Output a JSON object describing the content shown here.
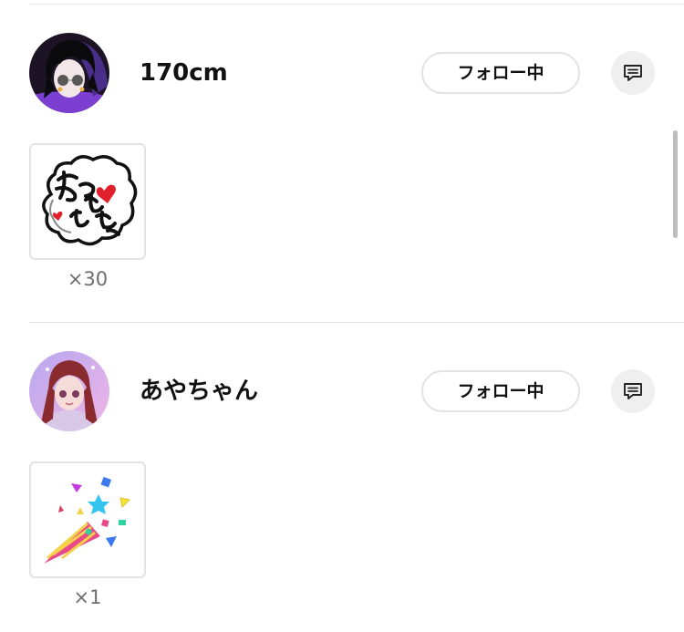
{
  "users": [
    {
      "name": "170cm",
      "follow_label": "フォロー中",
      "avatar_icon": "avatar-dark-hair-sunglasses",
      "gift": {
        "icon": "achacha-sticker-gift-icon",
        "count": "×30"
      }
    },
    {
      "name": "あやちゃん",
      "follow_label": "フォロー中",
      "avatar_icon": "avatar-pink-hair-girl",
      "gift": {
        "icon": "party-popper-gift-icon",
        "count": "×1"
      }
    }
  ],
  "colors": {
    "divider": "#e6e6e6",
    "button_border": "#e3e3e3",
    "message_button_bg": "#efefef",
    "count_text": "#6e6e6e",
    "heart_red": "#e0202a"
  }
}
